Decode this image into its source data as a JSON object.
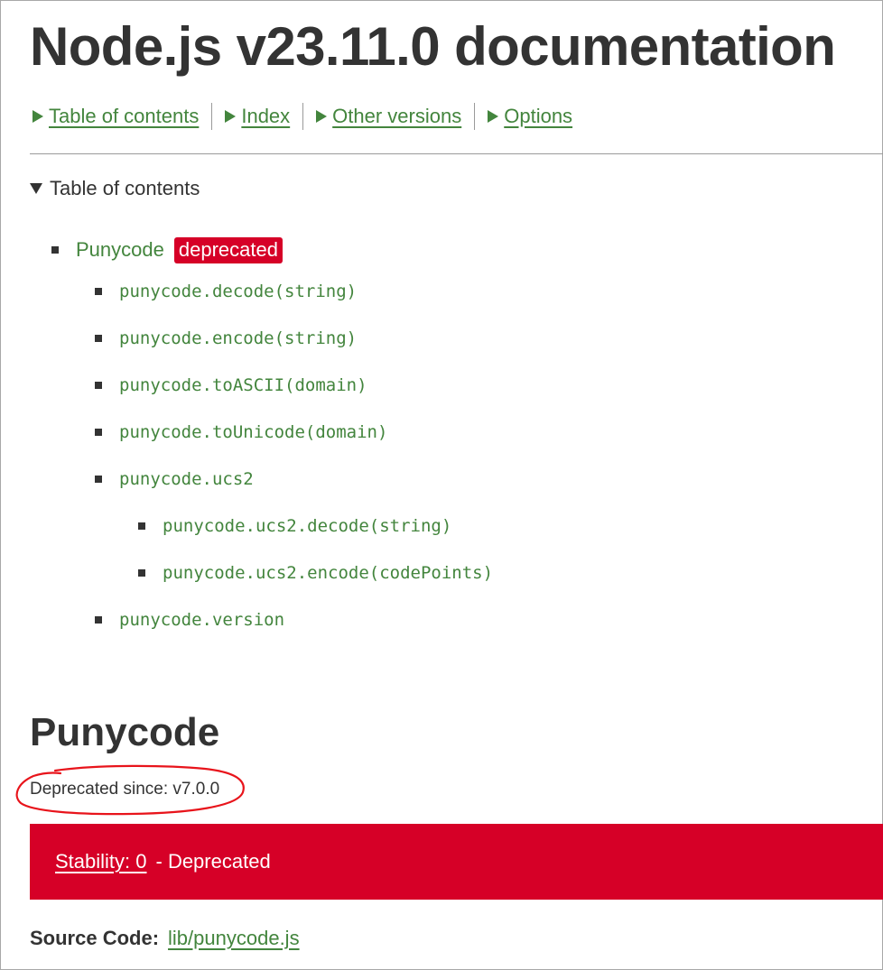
{
  "header": {
    "title": "Node.js v23.11.0 documentation"
  },
  "nav": {
    "items": [
      {
        "label": "Table of contents"
      },
      {
        "label": "Index"
      },
      {
        "label": "Other versions"
      },
      {
        "label": "Options"
      }
    ]
  },
  "toc": {
    "summary": "Table of contents",
    "top": {
      "label": "Punycode",
      "badge": "deprecated"
    },
    "items": [
      "punycode.decode(string)",
      "punycode.encode(string)",
      "punycode.toASCII(domain)",
      "punycode.toUnicode(domain)",
      "punycode.ucs2",
      "punycode.ucs2.decode(string)",
      "punycode.ucs2.encode(codePoints)",
      "punycode.version"
    ]
  },
  "section": {
    "heading": "Punycode",
    "deprecated_since": "Deprecated since: v7.0.0",
    "stability_link": "Stability: 0",
    "stability_text": "- Deprecated",
    "source_label": "Source Code:",
    "source_link": "lib/punycode.js"
  },
  "colors": {
    "link_green": "#43853d",
    "deprecated_red": "#d60027",
    "text": "#333333",
    "annotation_red": "#e8141b"
  }
}
